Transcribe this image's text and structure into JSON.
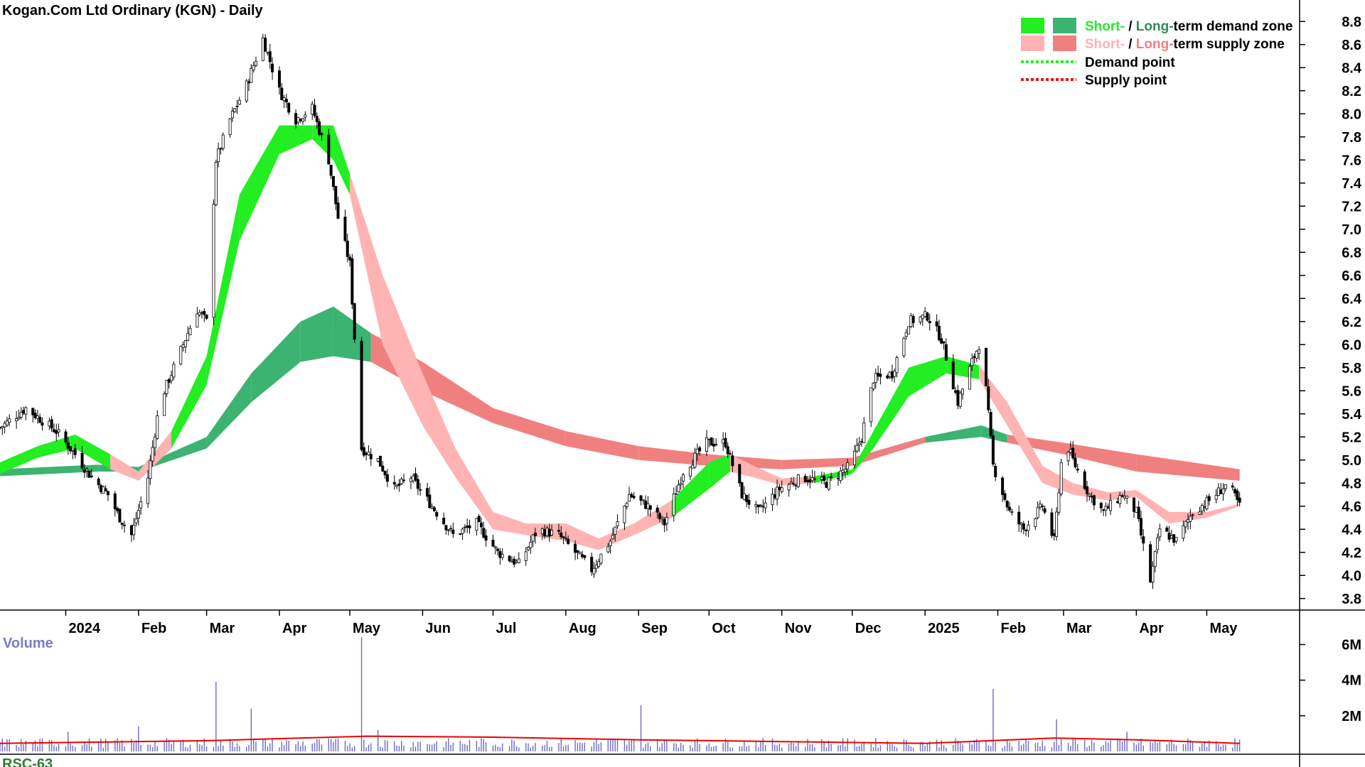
{
  "chart_data": {
    "type": "candlestick",
    "title": "Kogan.Com Ltd Ordinary (KGN) - Daily",
    "price_axis": {
      "ticks": [
        3.8,
        4.0,
        4.2,
        4.4,
        4.6,
        4.8,
        5.0,
        5.2,
        5.4,
        5.6,
        5.8,
        6.0,
        6.2,
        6.4,
        6.6,
        6.8,
        7.0,
        7.2,
        7.4,
        7.6,
        7.8,
        8.0,
        8.2,
        8.4,
        8.6,
        8.8
      ],
      "tick_labels": [
        "3.8",
        "4.0",
        "4.2",
        "4.4",
        "4.6",
        "4.8",
        "5.0",
        "5.2",
        "5.4",
        "5.6",
        "5.8",
        "6.0",
        "6.2",
        "6.4",
        "6.6",
        "6.8",
        "7.0",
        "7.2",
        "7.4",
        "7.6",
        "7.8",
        "8.0",
        "8.2",
        "8.4",
        "8.6",
        "8.8"
      ],
      "range": [
        3.7,
        8.9
      ]
    },
    "time_axis": {
      "range": [
        "2023-12-04",
        "2025-05-26"
      ],
      "months": [
        {
          "date": "2024-01-01",
          "label": "2024"
        },
        {
          "date": "2024-02-01",
          "label": "Feb"
        },
        {
          "date": "2024-03-01",
          "label": "Mar"
        },
        {
          "date": "2024-04-01",
          "label": "Apr"
        },
        {
          "date": "2024-05-01",
          "label": "May"
        },
        {
          "date": "2024-06-01",
          "label": "Jun"
        },
        {
          "date": "2024-07-01",
          "label": "Jul"
        },
        {
          "date": "2024-08-01",
          "label": "Aug"
        },
        {
          "date": "2024-09-01",
          "label": "Sep"
        },
        {
          "date": "2024-10-01",
          "label": "Oct"
        },
        {
          "date": "2024-11-01",
          "label": "Nov"
        },
        {
          "date": "2024-12-01",
          "label": "Dec"
        },
        {
          "date": "2025-01-01",
          "label": "2025"
        },
        {
          "date": "2025-02-01",
          "label": "Feb"
        },
        {
          "date": "2025-03-01",
          "label": "Mar"
        },
        {
          "date": "2025-04-01",
          "label": "Apr"
        },
        {
          "date": "2025-05-01",
          "label": "May"
        }
      ]
    },
    "price_path": [
      [
        "2023-12-04",
        5.28
      ],
      [
        "2023-12-15",
        5.45
      ],
      [
        "2023-12-28",
        5.25
      ],
      [
        "2024-01-05",
        5.05
      ],
      [
        "2024-01-12",
        4.85
      ],
      [
        "2024-01-19",
        4.7
      ],
      [
        "2024-01-24",
        4.5
      ],
      [
        "2024-01-29",
        4.35
      ],
      [
        "2024-02-05",
        4.85
      ],
      [
        "2024-02-10",
        5.5
      ],
      [
        "2024-02-18",
        5.9
      ],
      [
        "2024-02-26",
        6.3
      ],
      [
        "2024-03-01",
        6.2
      ],
      [
        "2024-03-05",
        7.6
      ],
      [
        "2024-03-11",
        7.95
      ],
      [
        "2024-03-18",
        8.25
      ],
      [
        "2024-03-25",
        8.65
      ],
      [
        "2024-04-01",
        8.2
      ],
      [
        "2024-04-08",
        7.95
      ],
      [
        "2024-04-15",
        8.05
      ],
      [
        "2024-04-22",
        7.6
      ],
      [
        "2024-04-26",
        7.1
      ],
      [
        "2024-05-01",
        6.7
      ],
      [
        "2024-05-06",
        5.1
      ],
      [
        "2024-05-13",
        5.0
      ],
      [
        "2024-05-20",
        4.75
      ],
      [
        "2024-05-27",
        4.85
      ],
      [
        "2024-06-05",
        4.6
      ],
      [
        "2024-06-14",
        4.35
      ],
      [
        "2024-06-24",
        4.45
      ],
      [
        "2024-07-03",
        4.2
      ],
      [
        "2024-07-12",
        4.1
      ],
      [
        "2024-07-20",
        4.4
      ],
      [
        "2024-07-29",
        4.35
      ],
      [
        "2024-08-05",
        4.2
      ],
      [
        "2024-08-12",
        4.05
      ],
      [
        "2024-08-20",
        4.3
      ],
      [
        "2024-08-28",
        4.7
      ],
      [
        "2024-09-05",
        4.6
      ],
      [
        "2024-09-12",
        4.45
      ],
      [
        "2024-09-20",
        4.9
      ],
      [
        "2024-09-30",
        5.15
      ],
      [
        "2024-10-08",
        5.15
      ],
      [
        "2024-10-15",
        4.7
      ],
      [
        "2024-10-22",
        4.55
      ],
      [
        "2024-10-31",
        4.75
      ],
      [
        "2024-11-10",
        4.85
      ],
      [
        "2024-11-20",
        4.8
      ],
      [
        "2024-11-30",
        4.95
      ],
      [
        "2024-12-05",
        5.2
      ],
      [
        "2024-12-10",
        5.7
      ],
      [
        "2024-12-18",
        5.75
      ],
      [
        "2024-12-25",
        6.2
      ],
      [
        "2025-01-02",
        6.25
      ],
      [
        "2025-01-08",
        6.05
      ],
      [
        "2025-01-15",
        5.5
      ],
      [
        "2025-01-21",
        5.85
      ],
      [
        "2025-01-25",
        6.05
      ],
      [
        "2025-01-30",
        4.95
      ],
      [
        "2025-02-06",
        4.55
      ],
      [
        "2025-02-12",
        4.4
      ],
      [
        "2025-02-20",
        4.6
      ],
      [
        "2025-02-25",
        4.3
      ],
      [
        "2025-03-01",
        5.2
      ],
      [
        "2025-03-06",
        4.95
      ],
      [
        "2025-03-12",
        4.7
      ],
      [
        "2025-03-18",
        4.55
      ],
      [
        "2025-03-26",
        4.7
      ],
      [
        "2025-04-01",
        4.55
      ],
      [
        "2025-04-07",
        3.95
      ],
      [
        "2025-04-11",
        4.4
      ],
      [
        "2025-04-18",
        4.3
      ],
      [
        "2025-04-25",
        4.55
      ],
      [
        "2025-05-02",
        4.65
      ],
      [
        "2025-05-10",
        4.8
      ],
      [
        "2025-05-15",
        4.6
      ]
    ],
    "volume_axis": {
      "ticks": [
        2000000,
        4000000,
        6000000
      ],
      "tick_labels": [
        "2M",
        "4M",
        "6M"
      ],
      "range": [
        0,
        6500000
      ]
    },
    "volume_spikes": [
      [
        "2024-01-02",
        1.1
      ],
      [
        "2024-02-01",
        1.4
      ],
      [
        "2024-03-05",
        3.9
      ],
      [
        "2024-03-20",
        2.4
      ],
      [
        "2024-05-06",
        6.4
      ],
      [
        "2024-05-13",
        1.2
      ],
      [
        "2024-07-28",
        2.4
      ],
      [
        "2024-09-02",
        2.6
      ],
      [
        "2025-01-30",
        3.5
      ],
      [
        "2025-02-26",
        1.8
      ],
      [
        "2025-03-28",
        1.1
      ]
    ],
    "volume_avg": [
      [
        "2023-12-04",
        0.45
      ],
      [
        "2024-03-01",
        0.6
      ],
      [
        "2024-05-08",
        0.85
      ],
      [
        "2024-07-01",
        0.8
      ],
      [
        "2024-09-01",
        0.65
      ],
      [
        "2024-11-01",
        0.55
      ],
      [
        "2025-01-01",
        0.45
      ],
      [
        "2025-02-25",
        0.75
      ],
      [
        "2025-04-01",
        0.65
      ],
      [
        "2025-05-15",
        0.45
      ]
    ],
    "zones": {
      "short_term": [
        [
          "2023-12-04",
          4.88,
          4.98
        ],
        [
          "2023-12-20",
          5.02,
          5.12
        ],
        [
          "2024-01-05",
          5.1,
          5.22
        ],
        [
          "2024-01-20",
          4.92,
          5.05
        ],
        [
          "2024-02-01",
          4.82,
          4.9
        ],
        [
          "2024-02-15",
          5.1,
          5.25
        ],
        [
          "2024-03-01",
          5.65,
          5.9
        ],
        [
          "2024-03-15",
          6.9,
          7.3
        ],
        [
          "2024-04-01",
          7.65,
          7.9
        ],
        [
          "2024-04-15",
          7.78,
          7.9
        ],
        [
          "2024-04-24",
          7.6,
          7.9
        ],
        [
          "2024-05-01",
          7.3,
          7.48
        ],
        [
          "2024-05-15",
          6.0,
          6.6
        ],
        [
          "2024-06-01",
          5.3,
          5.75
        ],
        [
          "2024-06-15",
          4.85,
          5.1
        ],
        [
          "2024-07-01",
          4.4,
          4.55
        ],
        [
          "2024-07-15",
          4.35,
          4.45
        ],
        [
          "2024-08-01",
          4.3,
          4.45
        ],
        [
          "2024-08-15",
          4.22,
          4.32
        ],
        [
          "2024-08-30",
          4.35,
          4.45
        ],
        [
          "2024-09-15",
          4.5,
          4.65
        ],
        [
          "2024-10-01",
          4.75,
          4.98
        ],
        [
          "2024-10-10",
          4.9,
          5.05
        ],
        [
          "2024-10-20",
          4.85,
          4.95
        ],
        [
          "2024-11-01",
          4.78,
          4.84
        ],
        [
          "2024-11-15",
          4.8,
          4.86
        ],
        [
          "2024-12-01",
          4.88,
          4.92
        ],
        [
          "2024-12-10",
          5.1,
          5.25
        ],
        [
          "2024-12-25",
          5.55,
          5.8
        ],
        [
          "2025-01-10",
          5.75,
          5.9
        ],
        [
          "2025-01-24",
          5.7,
          5.82
        ],
        [
          "2025-02-05",
          5.3,
          5.5
        ],
        [
          "2025-02-20",
          4.8,
          4.95
        ],
        [
          "2025-03-05",
          4.7,
          4.8
        ],
        [
          "2025-03-20",
          4.65,
          4.72
        ],
        [
          "2025-04-01",
          4.68,
          4.74
        ],
        [
          "2025-04-15",
          4.45,
          4.55
        ],
        [
          "2025-05-01",
          4.5,
          4.55
        ],
        [
          "2025-05-15",
          4.6,
          4.62
        ]
      ],
      "short_term_type": [
        "demand",
        "demand",
        "demand",
        "supply",
        "supply",
        "demand",
        "demand",
        "demand",
        "demand",
        "demand",
        "demand",
        "supply",
        "supply",
        "supply",
        "supply",
        "supply",
        "supply",
        "supply",
        "supply",
        "supply",
        "demand",
        "demand",
        "supply",
        "supply",
        "supply",
        "demand",
        "demand",
        "demand",
        "demand",
        "demand",
        "supply",
        "supply",
        "supply",
        "supply",
        "supply",
        "supply",
        "supply",
        "supply",
        "demand"
      ],
      "long_term": [
        [
          "2023-12-04",
          4.86,
          4.92
        ],
        [
          "2024-01-15",
          4.9,
          4.96
        ],
        [
          "2024-02-01",
          4.9,
          4.94
        ],
        [
          "2024-03-01",
          5.1,
          5.2
        ],
        [
          "2024-03-20",
          5.5,
          5.75
        ],
        [
          "2024-04-10",
          5.85,
          6.2
        ],
        [
          "2024-04-24",
          5.9,
          6.33
        ],
        [
          "2024-05-10",
          5.85,
          6.1
        ],
        [
          "2024-06-01",
          5.6,
          5.85
        ],
        [
          "2024-07-01",
          5.32,
          5.45
        ],
        [
          "2024-08-01",
          5.12,
          5.25
        ],
        [
          "2024-09-01",
          5.0,
          5.12
        ],
        [
          "2024-10-01",
          4.95,
          5.05
        ],
        [
          "2024-11-01",
          4.92,
          5.0
        ],
        [
          "2024-12-01",
          4.95,
          5.02
        ],
        [
          "2025-01-01",
          5.15,
          5.2
        ],
        [
          "2025-01-25",
          5.2,
          5.3
        ],
        [
          "2025-02-05",
          5.15,
          5.22
        ],
        [
          "2025-03-01",
          5.05,
          5.15
        ],
        [
          "2025-04-01",
          4.9,
          5.05
        ],
        [
          "2025-05-15",
          4.82,
          4.92
        ]
      ],
      "long_term_type": [
        "demand",
        "demand",
        "demand",
        "demand",
        "demand",
        "demand",
        "demand",
        "supply",
        "supply",
        "supply",
        "supply",
        "supply",
        "supply",
        "supply",
        "supply",
        "demand",
        "demand",
        "supply",
        "supply",
        "supply",
        "supply"
      ]
    },
    "legend": {
      "placement": "top-right",
      "line1": {
        "short": "Short-",
        "sep": " / ",
        "long": "Long-",
        "rest": "term demand zone"
      },
      "line2": {
        "short": "Short-",
        "sep": " / ",
        "long": "Long-",
        "rest": "term supply zone"
      },
      "demand_point": "Demand point",
      "supply_point": "Supply point"
    },
    "volume_label": "Volume",
    "lower_panel_label": "RSC-63",
    "colors": {
      "short_demand": "#22ee22",
      "long_demand": "#3cb371",
      "short_supply": "#ffb3b3",
      "long_supply": "#f08080",
      "short_supply_mixed": "#ff6a22",
      "demand_point": "#22ee22",
      "supply_point": "#ee1111",
      "volume_bar": "#6b6bc0",
      "volume_avg": "#ee0000",
      "legend_short_demand_text": "#22ee22",
      "legend_long_demand_text": "#2e8b57",
      "legend_short_supply_text": "#ffb3b3",
      "legend_long_supply_text": "#f08080"
    }
  }
}
